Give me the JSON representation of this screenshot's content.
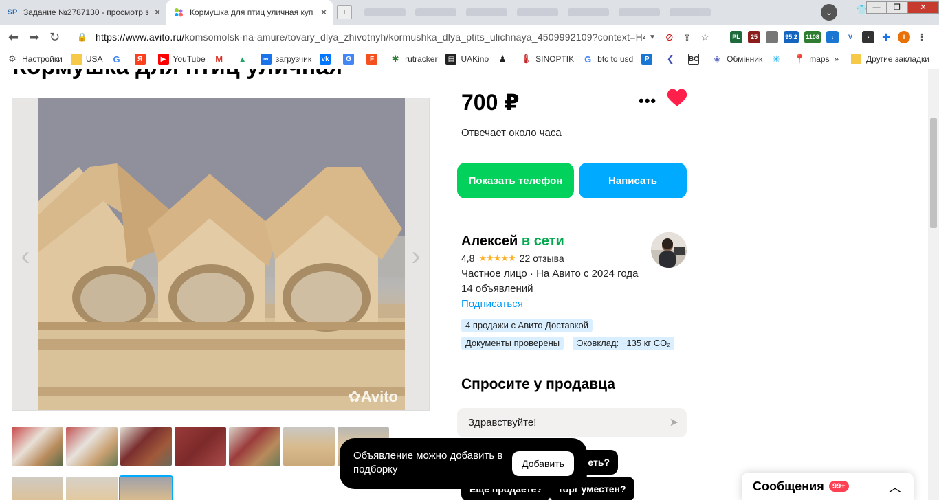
{
  "browser": {
    "tabs": [
      {
        "label": "Задание №2787130 - просмотр з",
        "favicon": "SP",
        "active": false
      },
      {
        "label": "Кормушка для птиц уличная куп",
        "favicon": "avito-icon",
        "active": true
      }
    ],
    "url_prefix": "https://www.avito.ru/",
    "url_rest": "komsomolsk-na-amure/tovary_dlya_zhivotnyh/kormushka_dlya_ptits_ulichnaya_4509992109?context=H4sIA...",
    "extension_badges": [
      "PL",
      "25",
      "95.2",
      "1108",
      "I"
    ],
    "bookmarks": [
      {
        "label": "Настройки",
        "icon": "gear-icon"
      },
      {
        "label": "USA",
        "icon": "folder-icon"
      },
      {
        "label": "",
        "icon": "google-icon"
      },
      {
        "label": "",
        "icon": "yandex-icon"
      },
      {
        "label": "YouTube",
        "icon": "youtube-icon"
      },
      {
        "label": "",
        "icon": "gmail-icon"
      },
      {
        "label": "",
        "icon": "drive-icon"
      },
      {
        "label": "загрузчик",
        "icon": "download-icon"
      },
      {
        "label": "",
        "icon": "vk-icon"
      },
      {
        "label": "",
        "icon": "translate-icon"
      },
      {
        "label": "",
        "icon": "f-icon"
      },
      {
        "label": "rutracker",
        "icon": "rutracker-icon"
      },
      {
        "label": "UAKino",
        "icon": "film-icon"
      },
      {
        "label": "",
        "icon": "figure-icon"
      },
      {
        "label": "SINOPTIK",
        "icon": "thermometer-icon"
      },
      {
        "label": "btc to usd",
        "icon": "google-icon"
      },
      {
        "label": "",
        "icon": "p-icon"
      },
      {
        "label": "",
        "icon": "arrow-icon"
      },
      {
        "label": "",
        "icon": "bc-icon"
      },
      {
        "label": "Обмінник",
        "icon": "exchange-icon"
      },
      {
        "label": "",
        "icon": "snow-icon"
      },
      {
        "label": "maps",
        "icon": "maps-icon"
      }
    ],
    "bookmarks_overflow": "»",
    "other_bookmarks": "Другие закладки"
  },
  "listing": {
    "title": "Кормушка для птиц уличная",
    "watermark": "Avito",
    "price": "700 ₽",
    "more": "•••",
    "response_time": "Отвечает около часа",
    "show_phone": "Показать телефон",
    "write": "Написать"
  },
  "seller": {
    "name": "Алексей",
    "status": "в сети",
    "rating": "4,8",
    "stars": "★★★★★",
    "reviews": "22 отзыва",
    "type": "Частное лицо · На Авито с 2024 года",
    "ads": "14 объявлений",
    "subscribe": "Подписаться",
    "badges": [
      "4 продажи с Авито Доставкой",
      "Документы проверены",
      "Эковклад: −135 кг CO₂"
    ]
  },
  "ask": {
    "title": "Спросите у продавца",
    "input_value": "Здравствуйте!",
    "chips": [
      "…еть?",
      "Ещё продаёте?",
      "Торг уместен?"
    ]
  },
  "toast": {
    "text": "Объявление можно добавить в подборку",
    "button": "Добавить"
  },
  "messages": {
    "label": "Сообщения",
    "count": "99+"
  },
  "colors": {
    "green": "#02d15c",
    "blue": "#00aaff",
    "heart": "#ff1f4b",
    "online": "#02a94f",
    "badge": "#d9efff"
  }
}
